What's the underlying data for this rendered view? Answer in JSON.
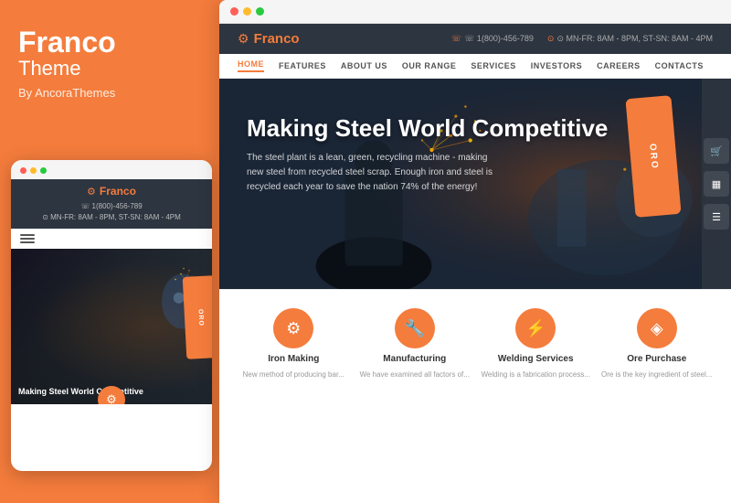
{
  "brand": {
    "title": "Franco",
    "subtitle": "Theme",
    "by": "By AncoraThemes"
  },
  "colors": {
    "accent": "#f47c3c",
    "dark": "#2d3540",
    "dot_red": "#ff6057",
    "dot_yellow": "#ffbb2c",
    "dot_green": "#29c940"
  },
  "mobile": {
    "logo": "Franco",
    "phone": "☏ 1(800)-456-789",
    "hours": "⊙ MN-FR: 8AM - 8PM, ST-SN: 8AM - 4PM",
    "hero_title": "Making Steel World Competitive",
    "card_text": "ORO"
  },
  "desktop": {
    "logo": "Franco",
    "phone": "☏ 1(800)-456-789",
    "hours": "⊙ MN-FR: 8AM - 8PM, ST-SN: 8AM - 4PM",
    "hero_title": "Making Steel World Competitive",
    "hero_desc": "The steel plant is a lean, green, recycling machine - making new steel from recycled steel scrap. Enough iron and steel is recycled each year to save the nation 74% of the energy!",
    "card_text": "ORO",
    "nav": [
      "HOME",
      "FEATURES",
      "ABOUT US",
      "OUR RANGE",
      "SERVICES",
      "INVESTORS",
      "CAREERS",
      "CONTACTS"
    ]
  },
  "services": [
    {
      "name": "Iron Making",
      "icon": "⚙",
      "desc": "New method of producing bar..."
    },
    {
      "name": "Manufacturing",
      "icon": "🔧",
      "desc": "We have examined all factors of..."
    },
    {
      "name": "Welding Services",
      "icon": "⚡",
      "desc": "Welding is a fabrication process..."
    },
    {
      "name": "Ore Purchase",
      "icon": "◈",
      "desc": "Ore is the key ingredient of steel..."
    }
  ],
  "titlebar": {
    "dot1": "red",
    "dot2": "yellow",
    "dot3": "green"
  }
}
